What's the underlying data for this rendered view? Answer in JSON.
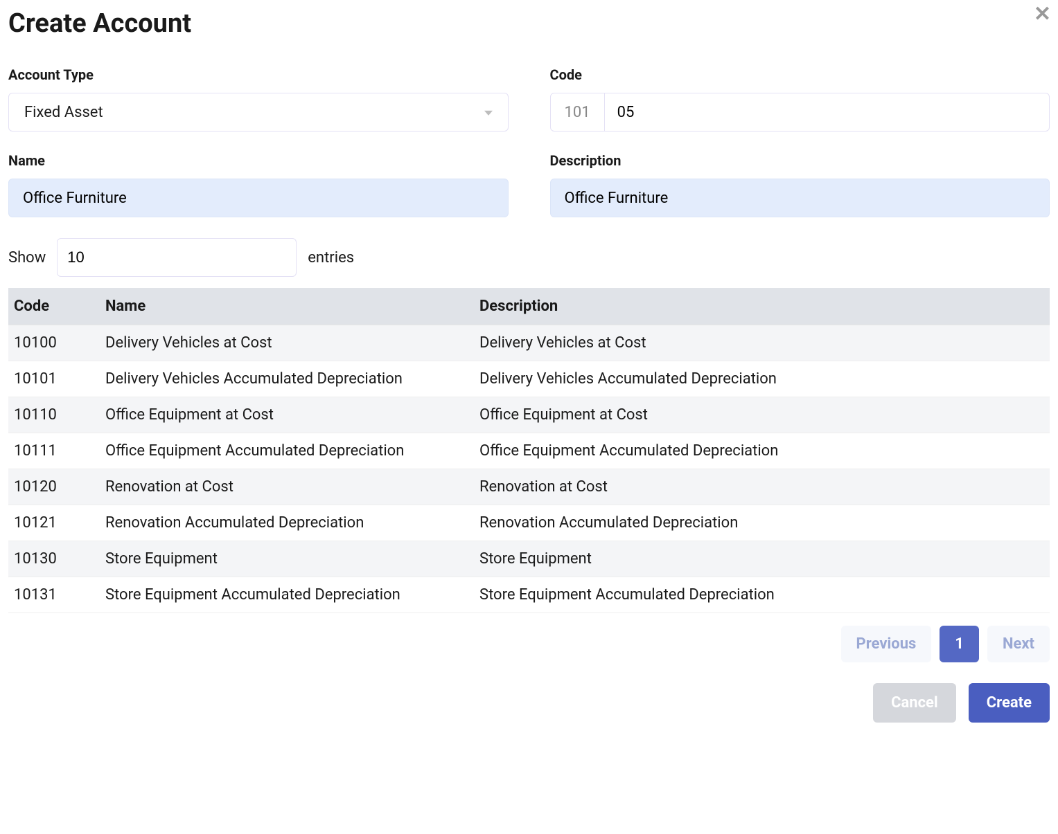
{
  "header": {
    "title": "Create Account"
  },
  "form": {
    "account_type": {
      "label": "Account Type",
      "value": "Fixed Asset"
    },
    "code": {
      "label": "Code",
      "prefix": "101",
      "value": "05"
    },
    "name": {
      "label": "Name",
      "value": "Office Furniture"
    },
    "description": {
      "label": "Description",
      "value": "Office Furniture"
    }
  },
  "table": {
    "show_label_before": "Show",
    "show_value": "10",
    "show_label_after": "entries",
    "columns": [
      "Code",
      "Name",
      "Description"
    ],
    "rows": [
      {
        "code": "10100",
        "name": "Delivery Vehicles at Cost",
        "description": "Delivery Vehicles at Cost"
      },
      {
        "code": "10101",
        "name": "Delivery Vehicles Accumulated Depreciation",
        "description": "Delivery Vehicles Accumulated Depreciation"
      },
      {
        "code": "10110",
        "name": "Office Equipment at Cost",
        "description": "Office Equipment at Cost"
      },
      {
        "code": "10111",
        "name": "Office Equipment Accumulated Depreciation",
        "description": "Office Equipment Accumulated Depreciation"
      },
      {
        "code": "10120",
        "name": "Renovation at Cost",
        "description": "Renovation at Cost"
      },
      {
        "code": "10121",
        "name": "Renovation Accumulated Depreciation",
        "description": "Renovation Accumulated Depreciation"
      },
      {
        "code": "10130",
        "name": "Store Equipment",
        "description": "Store Equipment"
      },
      {
        "code": "10131",
        "name": "Store Equipment Accumulated Depreciation",
        "description": "Store Equipment Accumulated Depreciation"
      }
    ]
  },
  "pagination": {
    "previous": "Previous",
    "current": "1",
    "next": "Next"
  },
  "buttons": {
    "cancel": "Cancel",
    "create": "Create"
  }
}
